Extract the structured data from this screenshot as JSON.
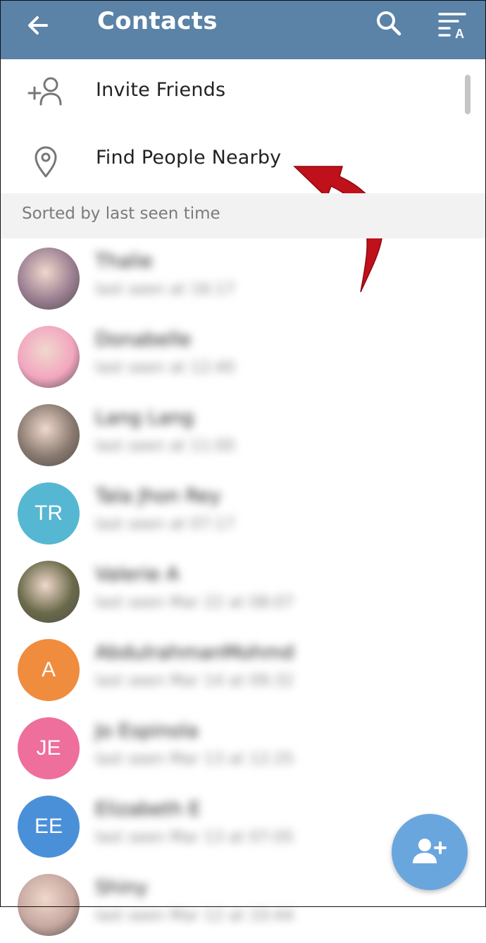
{
  "header": {
    "title": "Contacts",
    "bg_color": "#5b82a7",
    "icons": [
      "back-arrow-icon",
      "search-icon",
      "sort-icon"
    ]
  },
  "menu": {
    "invite_label": "Invite Friends",
    "nearby_label": "Find People Nearby"
  },
  "section_header": "Sorted by last seen time",
  "contacts": [
    {
      "name": "Thalie",
      "status": "last seen at 16:17",
      "avatar": "photo",
      "color": "#9b7f92"
    },
    {
      "name": "Donabelle",
      "status": "last seen at 12:40",
      "avatar": "photo",
      "color": "#f2a6c0"
    },
    {
      "name": "Lang Lang",
      "status": "last seen at 11:00",
      "avatar": "photo",
      "color": "#8a7a70"
    },
    {
      "name": "Tala Jhon Rey",
      "status": "last seen at 07:17",
      "initials": "TR",
      "color": "#56b7d2"
    },
    {
      "name": "Valerie A",
      "status": "last seen Mar 22 at 08:07",
      "avatar": "photo",
      "color": "#6a6a4a"
    },
    {
      "name": "AbdulrahmanMohmd",
      "status": "last seen Mar 14 at 09:32",
      "initials": "A",
      "color": "#f08c3e"
    },
    {
      "name": "Jo Espinola",
      "status": "last seen Mar 13 at 12:25",
      "initials": "JE",
      "color": "#ee6e9c"
    },
    {
      "name": "Elizabeth E",
      "status": "last seen Mar 13 at 07:05",
      "initials": "EE",
      "color": "#4a90d9"
    },
    {
      "name": "Shiny",
      "status": "last seen Mar 12 at 10:44",
      "avatar": "photo",
      "color": "#c7a8a0"
    }
  ],
  "fab_icon": "add-contact-icon",
  "annotation_arrow_color": "#c0101a"
}
